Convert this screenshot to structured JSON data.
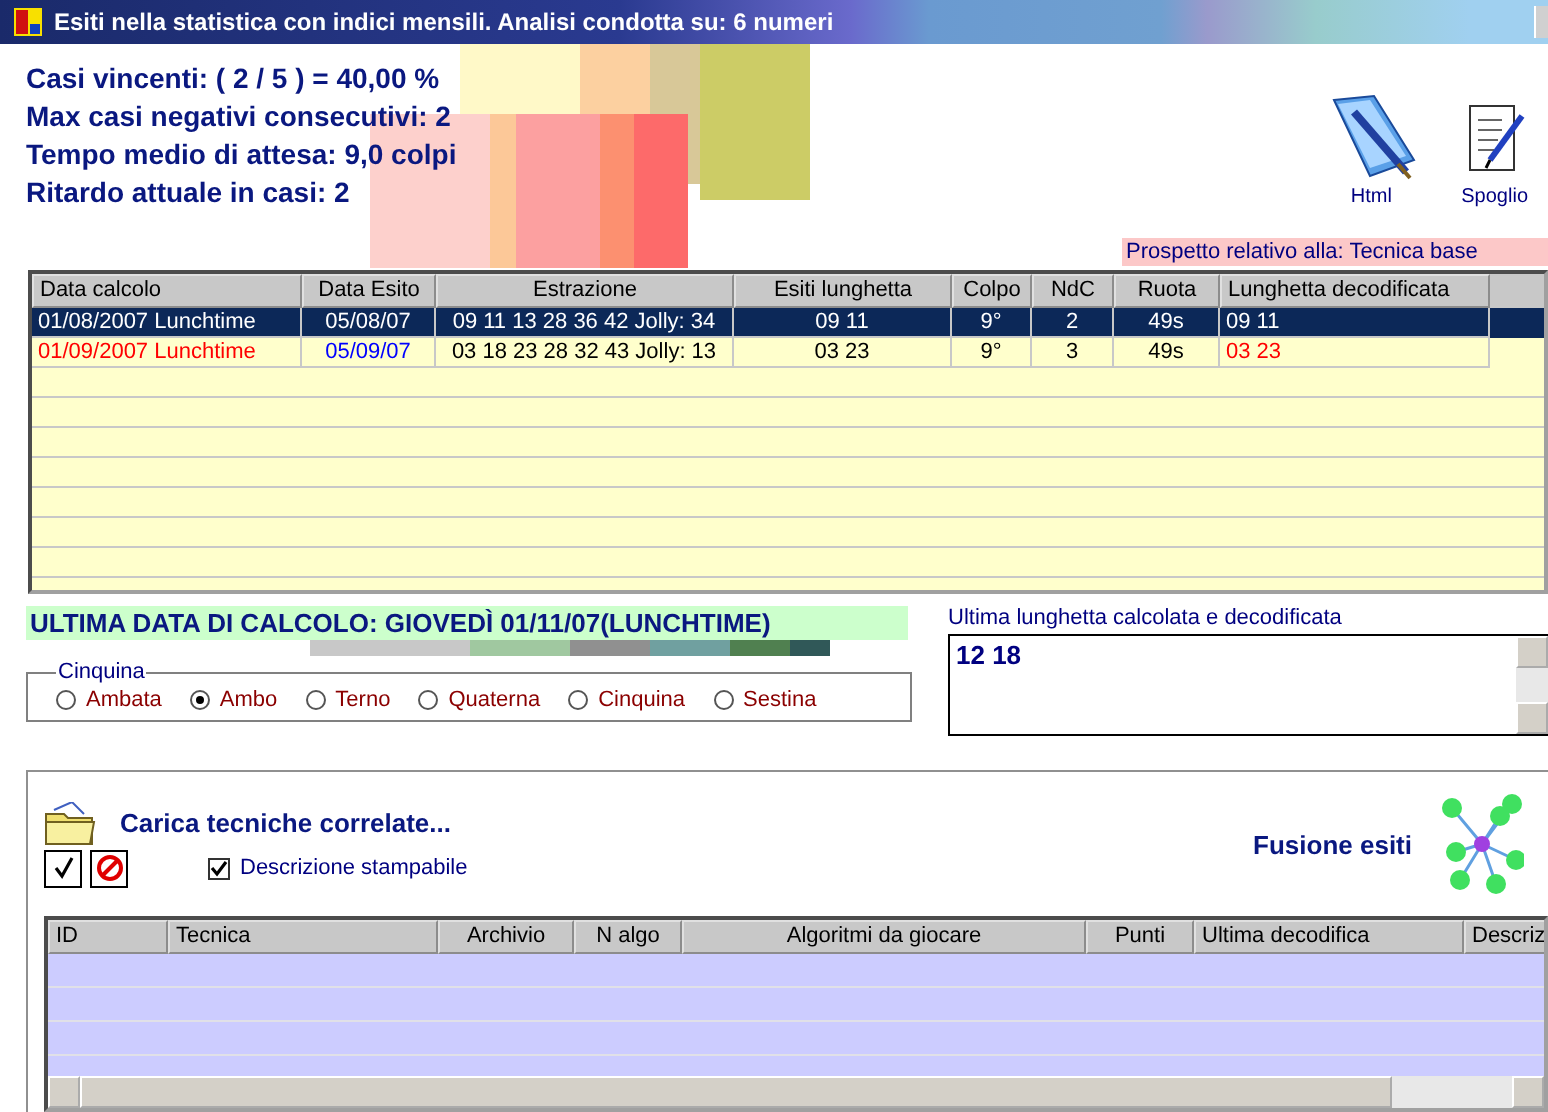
{
  "window": {
    "title": "Esiti nella statistica con indici mensili. Analisi condotta su: 6 numeri"
  },
  "stats": [
    "Casi vincenti: ( 2 / 5 ) = 40,00 %",
    "Max casi negativi consecutivi: 2",
    "Tempo medio di attesa: 9,0 colpi",
    "Ritardo attuale in casi: 2"
  ],
  "toolbar": [
    {
      "label": "Html",
      "kind": "book"
    },
    {
      "label": "Spoglio",
      "kind": "scroll"
    }
  ],
  "prospetto": "Prospetto relativo alla: Tecnica base",
  "table": {
    "columns": [
      "Data calcolo",
      "Data Esito",
      "Estrazione",
      "Esiti lunghetta",
      "Colpo",
      "NdC",
      "Ruota",
      "Lunghetta decodificata"
    ],
    "rows": [
      {
        "selected": true,
        "cells": [
          {
            "text": "01/08/2007 Lunchtime"
          },
          {
            "text": "05/08/07"
          },
          {
            "text": "09 11 13 28 36 42 Jolly: 34"
          },
          {
            "text": "09 11"
          },
          {
            "text": "9°"
          },
          {
            "text": "2"
          },
          {
            "text": "49s"
          },
          {
            "text": "09 11"
          }
        ]
      },
      {
        "selected": false,
        "cells": [
          {
            "text": "01/09/2007 Lunchtime",
            "color": "#ff0000"
          },
          {
            "text": "05/09/07",
            "color": "#0000ff"
          },
          {
            "text": "03 18 23 28 32 43 Jolly: 13"
          },
          {
            "text": "03 23"
          },
          {
            "text": "9°"
          },
          {
            "text": "3"
          },
          {
            "text": "49s"
          },
          {
            "text": "03 23",
            "color": "#ff0000"
          }
        ]
      }
    ]
  },
  "ultima_data": "ULTIMA DATA DI CALCOLO: GIOVEDÌ 01/11/07(LUNCHTIME)",
  "cinquina": {
    "title": "Cinquina",
    "options": [
      {
        "label": "Ambata",
        "selected": false
      },
      {
        "label": "Ambo",
        "selected": true
      },
      {
        "label": "Terno",
        "selected": false
      },
      {
        "label": "Quaterna",
        "selected": false
      },
      {
        "label": "Cinquina",
        "selected": false
      },
      {
        "label": "Sestina",
        "selected": false
      }
    ]
  },
  "lunghetta": {
    "label": "Ultima lunghetta calcolata e decodificata",
    "value": "12 18"
  },
  "correlate": {
    "title": "Carica tecniche correlate...",
    "checkbox": {
      "label": "Descrizione stampabile",
      "checked": true
    },
    "fusione": "Fusione esiti",
    "columns": [
      "ID",
      "Tecnica",
      "Archivio",
      "N algo",
      "Algoritmi da giocare",
      "Punti",
      "Ultima decodifica",
      "Descriz"
    ]
  }
}
